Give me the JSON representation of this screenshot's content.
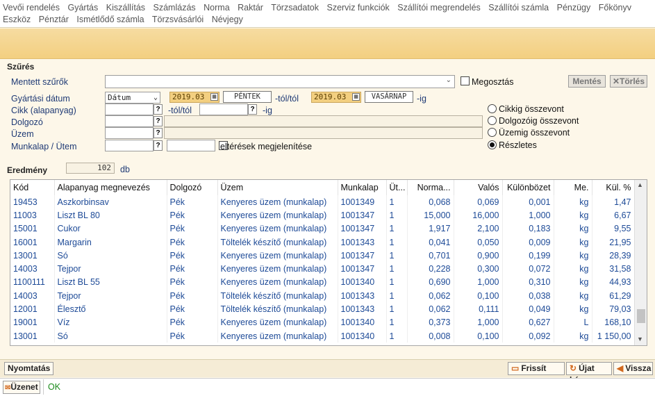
{
  "menu": [
    "Vevői rendelés",
    "Gyártás",
    "Kiszállítás",
    "Számlázás",
    "Norma",
    "Raktár",
    "Törzsadatok",
    "Szerviz funkciók",
    "Szállítói megrendelés",
    "Szállítói számla",
    "Pénzügy",
    "Főkönyv",
    "Eszköz",
    "Pénztár",
    "Ismétlődő számla",
    "Törzsvásárlói",
    "Névjegy"
  ],
  "filter": {
    "title": "Szűrés",
    "saved_filters_label": "Mentett szűrők",
    "share_label": "Megosztás",
    "save_button": "Mentés",
    "delete_button": "Törlés",
    "prod_date_label": "Gyártási dátum",
    "date_type": "Dátum",
    "date_from": "2019.03",
    "date_from_day": "PÉNTEK",
    "from_suffix": "-tól/tól",
    "date_to": "2019.03",
    "date_to_day": "VASÁRNAP",
    "to_suffix": "-ig",
    "item_label": "Cikk (alapanyag)",
    "item_from_suffix": "-tól/tól",
    "item_to_suffix": "-ig",
    "worker_label": "Dolgozó",
    "plant_label": "Üzem",
    "worksheet_label": "Munkalap / Ütem",
    "diff_label": "eltérések megjelenítése",
    "q": "?",
    "radios": [
      {
        "label": "Cikkig összevont",
        "checked": false
      },
      {
        "label": "Dolgozóig összevont",
        "checked": false
      },
      {
        "label": "Üzemig összevont",
        "checked": false
      },
      {
        "label": "Részletes",
        "checked": true
      }
    ]
  },
  "result": {
    "title": "Eredmény",
    "count": "102",
    "unit": "db"
  },
  "table": {
    "headers": [
      "Kód",
      "Alapanyag megnevezés",
      "Dolgozó",
      "Üzem",
      "Munkalap",
      "Üt...",
      "Norma...",
      "Valós",
      "Különbözet",
      "Me.",
      "Kül. %"
    ],
    "rows": [
      [
        "19453",
        "Aszkorbinsav",
        "Pék",
        "Kenyeres üzem (munkalap)",
        "1001349",
        "1",
        "0,068",
        "0,069",
        "0,001",
        "kg",
        "1,47"
      ],
      [
        "11003",
        "Liszt BL 80",
        "Pék",
        "Kenyeres üzem (munkalap)",
        "1001347",
        "1",
        "15,000",
        "16,000",
        "1,000",
        "kg",
        "6,67"
      ],
      [
        "15001",
        "Cukor",
        "Pék",
        "Kenyeres üzem (munkalap)",
        "1001347",
        "1",
        "1,917",
        "2,100",
        "0,183",
        "kg",
        "9,55"
      ],
      [
        "16001",
        "Margarin",
        "Pék",
        "Töltelék készítő (munkalap)",
        "1001343",
        "1",
        "0,041",
        "0,050",
        "0,009",
        "kg",
        "21,95"
      ],
      [
        "13001",
        "Só",
        "Pék",
        "Kenyeres üzem (munkalap)",
        "1001347",
        "1",
        "0,701",
        "0,900",
        "0,199",
        "kg",
        "28,39"
      ],
      [
        "14003",
        "Tejpor",
        "Pék",
        "Kenyeres üzem (munkalap)",
        "1001347",
        "1",
        "0,228",
        "0,300",
        "0,072",
        "kg",
        "31,58"
      ],
      [
        "1100111",
        "Liszt BL 55",
        "Pék",
        "Kenyeres üzem (munkalap)",
        "1001340",
        "1",
        "0,690",
        "1,000",
        "0,310",
        "kg",
        "44,93"
      ],
      [
        "14003",
        "Tejpor",
        "Pék",
        "Töltelék készítő (munkalap)",
        "1001343",
        "1",
        "0,062",
        "0,100",
        "0,038",
        "kg",
        "61,29"
      ],
      [
        "12001",
        "Élesztő",
        "Pék",
        "Töltelék készítő (munkalap)",
        "1001343",
        "1",
        "0,062",
        "0,111",
        "0,049",
        "kg",
        "79,03"
      ],
      [
        "19001",
        "Víz",
        "Pék",
        "Kenyeres üzem (munkalap)",
        "1001340",
        "1",
        "0,373",
        "1,000",
        "0,627",
        "L",
        "168,10"
      ],
      [
        "13001",
        "Só",
        "Pék",
        "Kenyeres üzem (munkalap)",
        "1001340",
        "1",
        "0,008",
        "0,100",
        "0,092",
        "kg",
        "1 150,00"
      ]
    ]
  },
  "bottom": {
    "print_button": "Nyomtatás",
    "refresh_button": "Frissít",
    "new_query_button": "Újat kér",
    "back_button": "Vissza"
  },
  "status": {
    "message_button": "Üzenet",
    "message": "OK"
  }
}
